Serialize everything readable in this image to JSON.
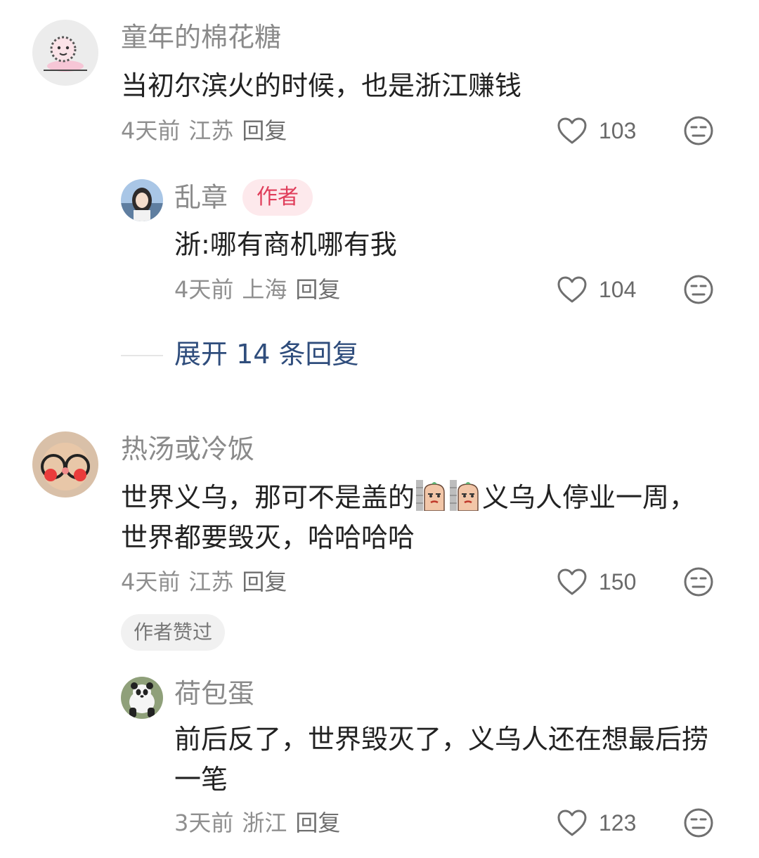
{
  "comments": [
    {
      "username": "童年的棉花糖",
      "content": "当初尔滨火的时候，也是浙江赚钱",
      "time": "4天前",
      "location": "江苏",
      "reply_label": "回复",
      "likes": "103",
      "replies": [
        {
          "username": "乱章",
          "badge": "作者",
          "content": "浙:哪有商机哪有我",
          "time": "4天前",
          "location": "上海",
          "reply_label": "回复",
          "likes": "104"
        }
      ],
      "expand_label": "展开 14 条回复"
    },
    {
      "username": "热汤或冷饭",
      "content_part1": "世界义乌，那可不是盖的",
      "content_part2": "义乌人停业一周，世界都要毁灭，哈哈哈哈",
      "time": "4天前",
      "location": "江苏",
      "reply_label": "回复",
      "likes": "150",
      "author_liked": "作者赞过",
      "replies": [
        {
          "username": "荷包蛋",
          "content": "前后反了，世界毁灭了，义乌人还在想最后捞一笔",
          "time": "3天前",
          "location": "浙江",
          "reply_label": "回复",
          "likes": "123"
        }
      ]
    }
  ],
  "colors": {
    "accent_link": "#2f4d7c",
    "author_badge_text": "#e03d5a",
    "author_badge_bg": "#fde9ec"
  },
  "icons": [
    "heart-outline-icon",
    "dislike-face-icon",
    "sticker-emoji"
  ]
}
